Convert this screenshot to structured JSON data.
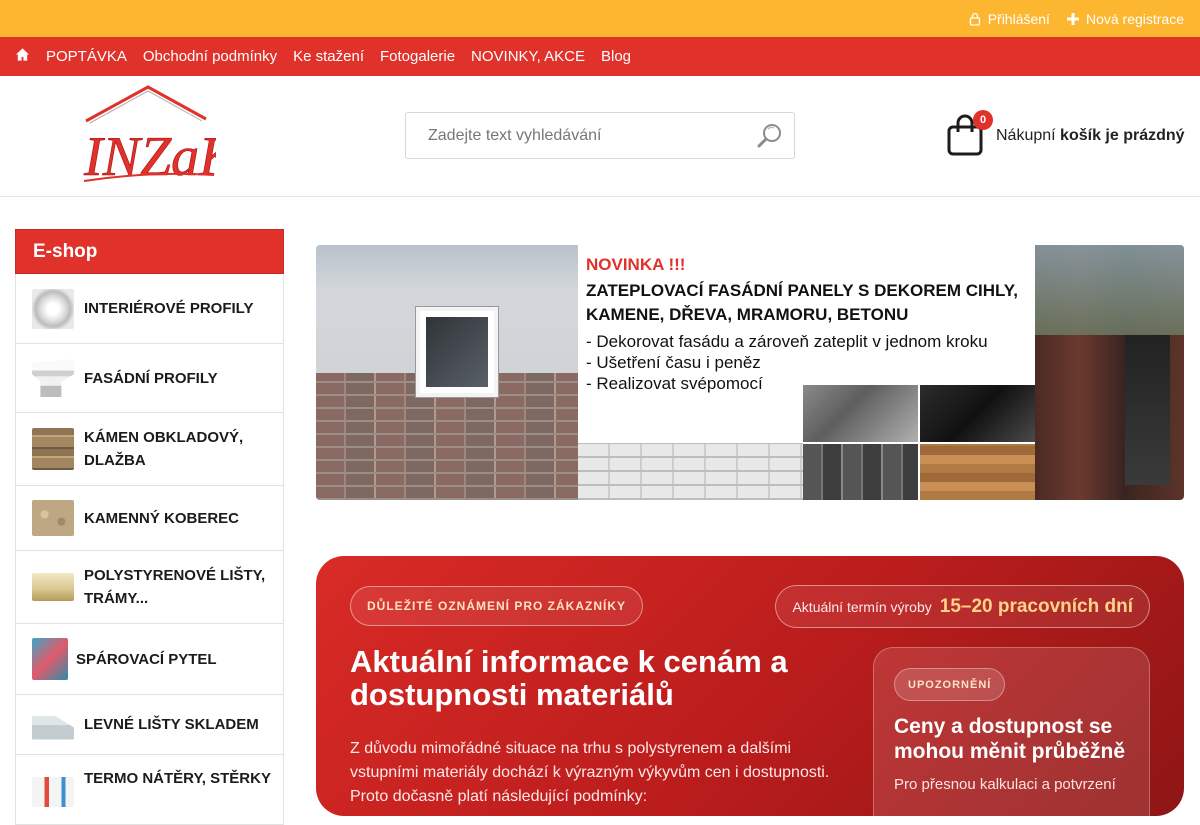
{
  "topbar": {
    "login": "Přihlášení",
    "register": "Nová registrace"
  },
  "nav": {
    "items": [
      "POPTÁVKA",
      "Obchodní podmínky",
      "Ke stažení",
      "Fotogalerie",
      "NOVINKY, AKCE",
      "Blog"
    ]
  },
  "header": {
    "logo_text": "INZaK",
    "search_placeholder": "Zadejte text vyhledávání",
    "cart_count": "0",
    "cart_label": "Nákupní",
    "cart_status": "košík je prázdný"
  },
  "sidebar": {
    "title": "E-shop",
    "items": [
      {
        "label": "INTERIÉROVÉ PROFILY",
        "icon": "rosette-thumb"
      },
      {
        "label": "FASÁDNÍ PROFILY",
        "icon": "cornice-thumb"
      },
      {
        "label": "KÁMEN OBKLADOVÝ, DLAŽBA",
        "icon": "stone-thumb"
      },
      {
        "label": "KAMENNÝ KOBEREC",
        "icon": "gravel-thumb"
      },
      {
        "label": "POLYSTYRENOVÉ LIŠTY, TRÁMY...",
        "icon": "beam-thumb"
      },
      {
        "label": "SPÁROVACÍ PYTEL",
        "icon": "bag-thumb"
      },
      {
        "label": "LEVNÉ LIŠTY SKLADEM",
        "icon": "molding-thumb"
      },
      {
        "label": "TERMO NÁTĚRY, STĚRKY",
        "icon": "paint-thumb"
      }
    ]
  },
  "banner": {
    "headline": "NOVINKA !!!",
    "subheadline": "ZATEPLOVACÍ FASÁDNÍ PANELY S DEKOREM CIHLY, KAMENE, DŘEVA, MRAMORU, BETONU",
    "bullets": [
      "- Dekorovat fasádu a zároveň zateplit v jednom kroku",
      "- Ušetření času i peněz",
      "- Realizovat svépomocí"
    ]
  },
  "notice": {
    "badge": "DŮLEŽITÉ OZNÁMENÍ PRO ZÁKAZNÍKY",
    "term_label": "Aktuální termín výroby",
    "term_value": "15–20 pracovních dní",
    "title": "Aktuální informace k cenám a dostupnosti materiálů",
    "text": "Z důvodu mimořádné situace na trhu s polystyrenem a dalšími vstupními materiály dochází k výrazným výkyvům cen i dostupnosti. Proto dočasně platí následující podmínky:",
    "card_tag": "UPOZORNĚNÍ",
    "card_title": "Ceny a dostupnost se mohou měnit průběžně",
    "card_text": "Pro přesnou kalkulaci a potvrzení"
  },
  "colors": {
    "topbar": "#fcb62f",
    "nav": "#e0312b",
    "accent": "#e0312b"
  }
}
